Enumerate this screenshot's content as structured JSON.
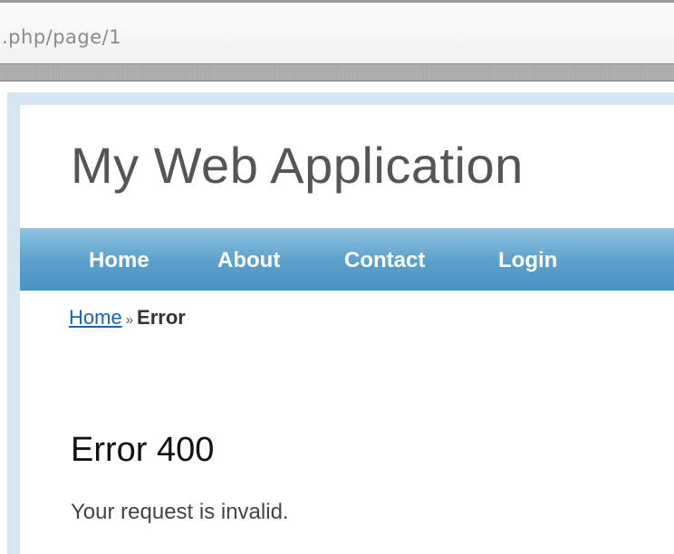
{
  "browser": {
    "url": ".php/page/1"
  },
  "site": {
    "title": "My Web Application"
  },
  "menu": {
    "items": [
      {
        "label": "Home"
      },
      {
        "label": "About"
      },
      {
        "label": "Contact"
      },
      {
        "label": "Login"
      }
    ]
  },
  "breadcrumbs": {
    "home": "Home",
    "separator": "»",
    "current": "Error"
  },
  "content": {
    "heading": "Error 400",
    "message": "Your request is invalid."
  },
  "colors": {
    "menu_bar": "#5a9fcb",
    "link": "#1a63b8",
    "frame": "#d7e7f2"
  }
}
